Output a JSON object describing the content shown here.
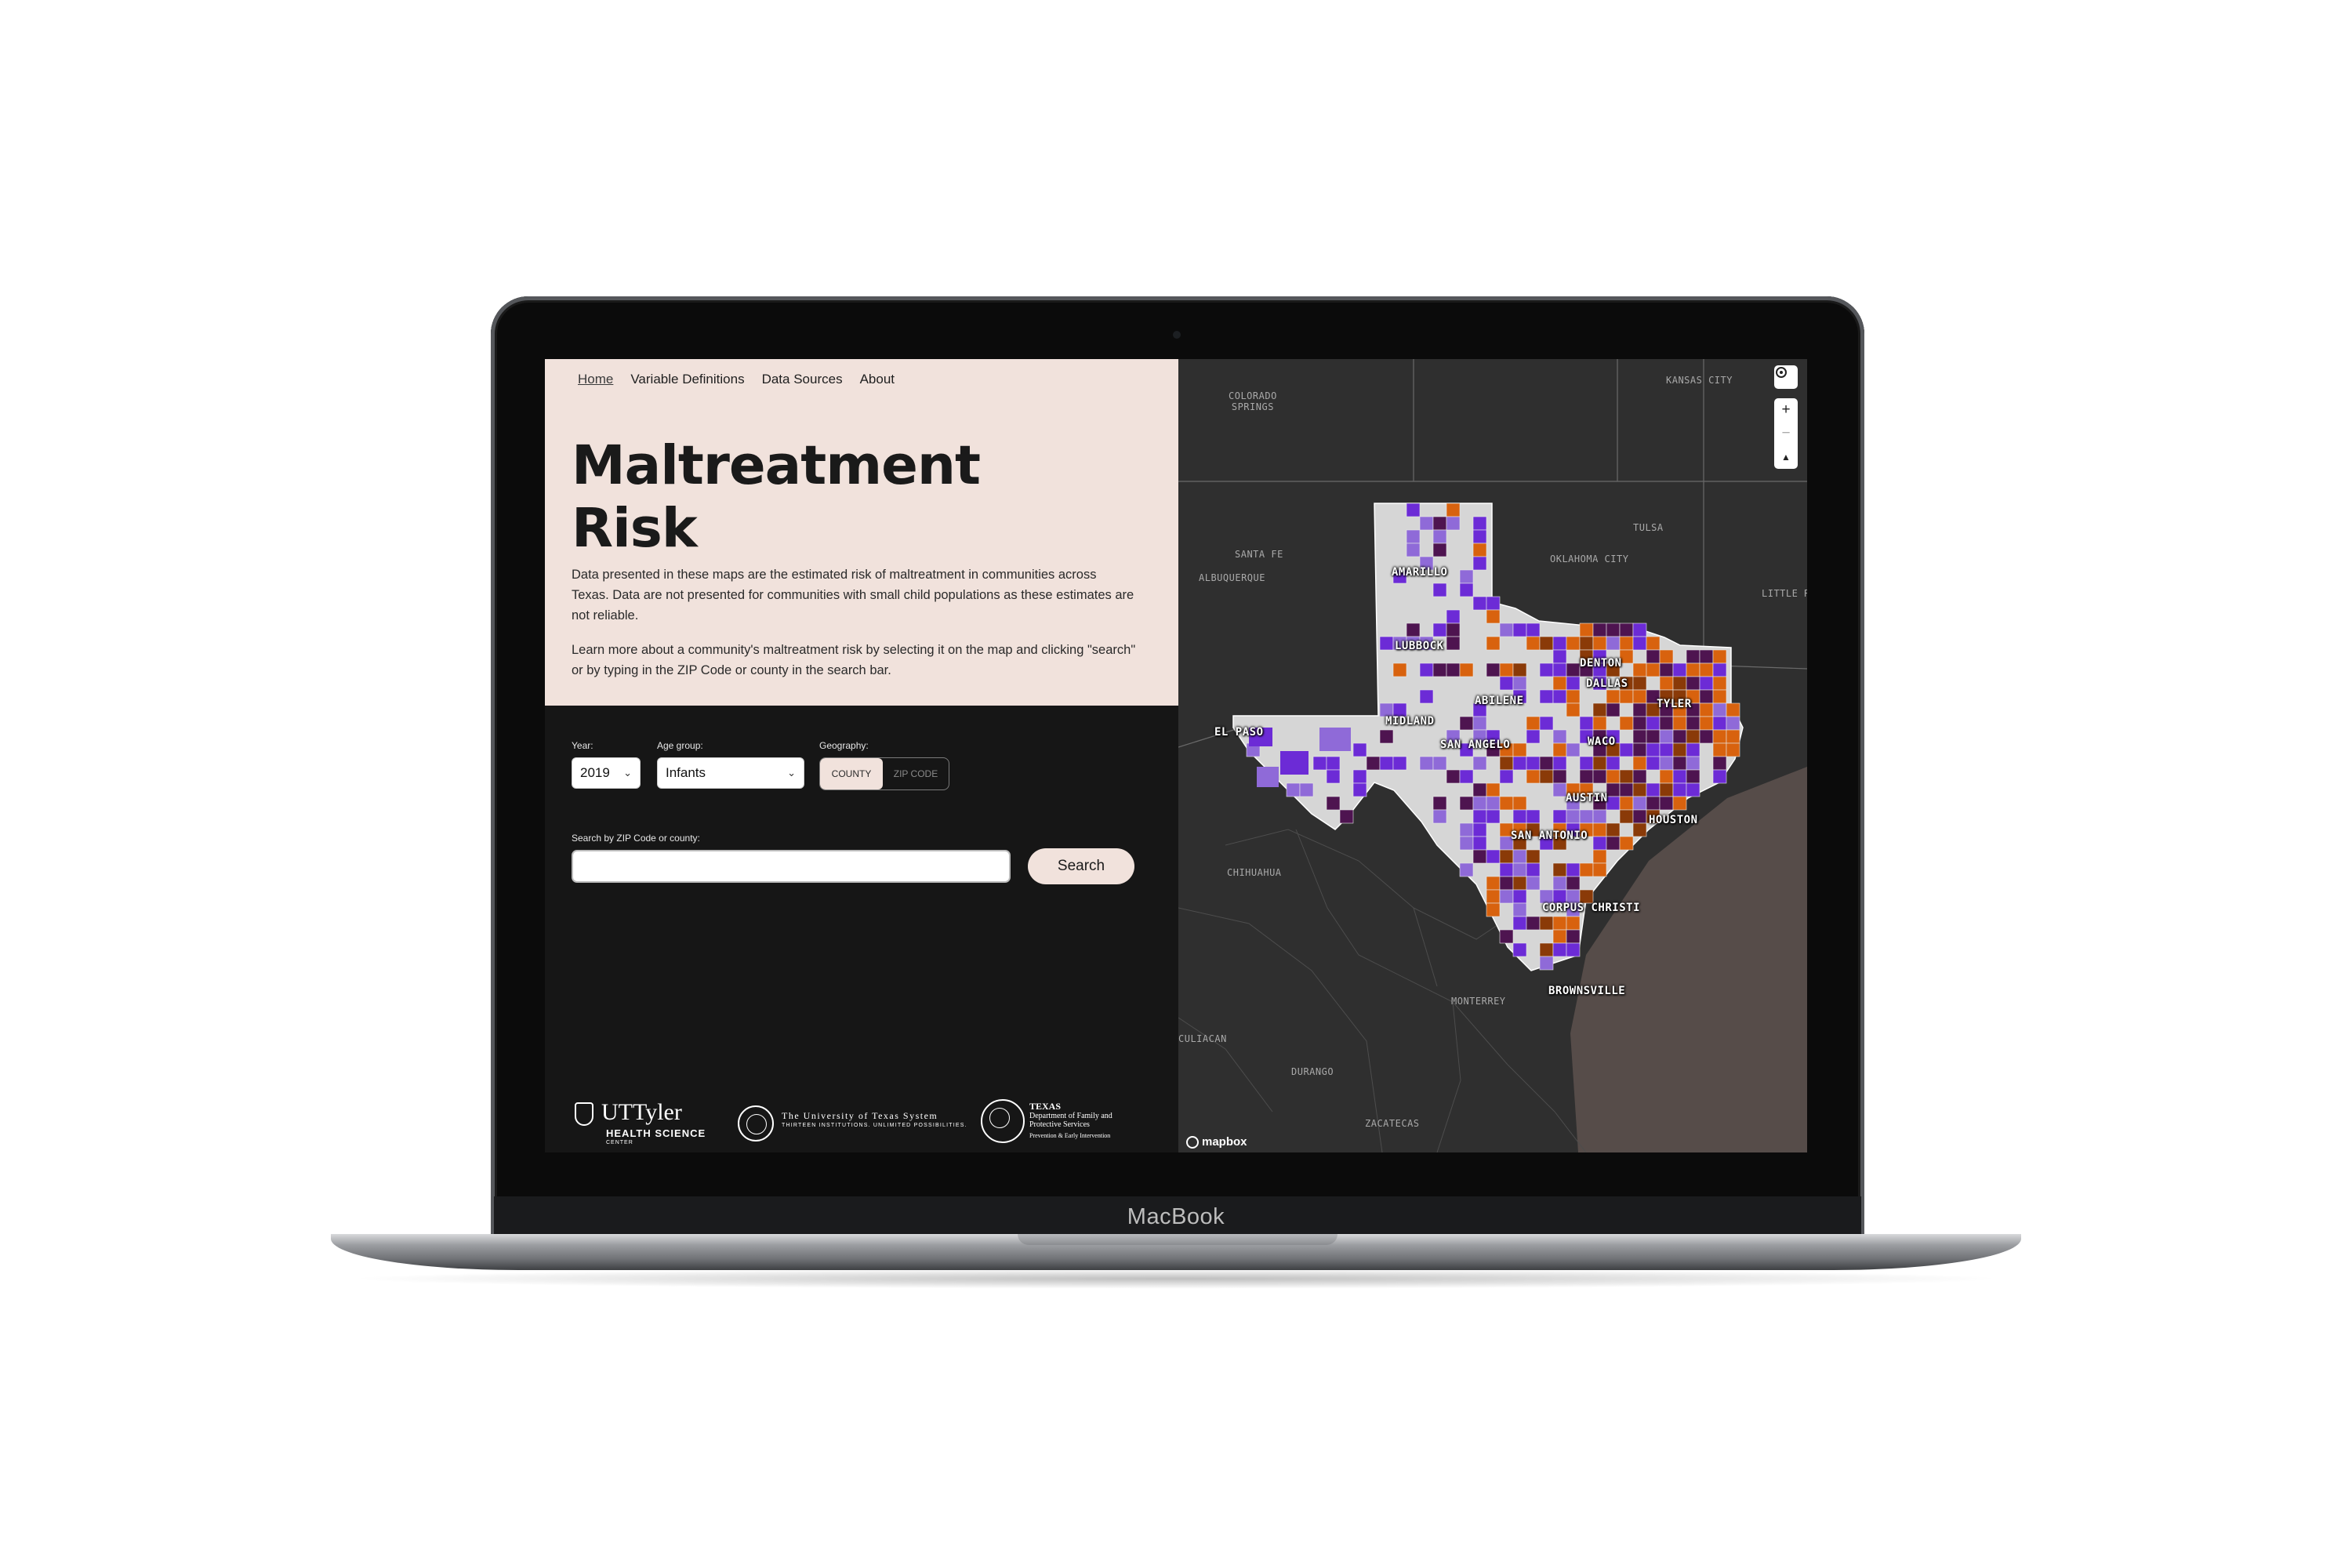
{
  "device": {
    "brand": "MacBook"
  },
  "nav": {
    "home": "Home",
    "variables": "Variable Definitions",
    "sources": "Data Sources",
    "about": "About"
  },
  "hero": {
    "title": "Maltreatment Risk",
    "p1": "Data presented in these maps are the estimated risk of maltreatment in communities across Texas. Data are not presented for communities with small child populations as these estimates are not reliable.",
    "p2": "Learn more about a community's maltreatment risk by selecting it on the map and clicking \"search\" or by typing in the ZIP Code or county in the search bar."
  },
  "controls": {
    "year_label": "Year:",
    "year_value": "2019",
    "age_label": "Age group:",
    "age_value": "Infants",
    "geo_label": "Geography:",
    "geo_county": "COUNTY",
    "geo_zip": "ZIP CODE",
    "search_label": "Search by ZIP Code or county:",
    "search_placeholder": "",
    "search_button": "Search"
  },
  "logos": {
    "ut_name": "UTTyler",
    "ut_sub": "HEALTH SCIENCE",
    "ut_sub2": "CENTER",
    "uts_line1": "The University of Texas System",
    "uts_line2": "THIRTEEN INSTITUTIONS. UNLIMITED POSSIBILITIES.",
    "dfps_line1": "TEXAS",
    "dfps_line2": "Department of Family and Protective Services",
    "dfps_line3": "Prevention & Early Intervention"
  },
  "map": {
    "colors": {
      "background": "#2f2f2f",
      "gulf": "#5a4f4c",
      "texas_gray": "#d6d6d6",
      "lavender": "#8f6ad8",
      "purple": "#6c2bd6",
      "dark_purple": "#4e1450",
      "orange": "#d8620e",
      "brown": "#8a3a08"
    },
    "region_labels": {
      "colorado": "COLORADO\nSPRINGS",
      "kansas": "KANSAS CITY",
      "santafe": "SANTA FE",
      "albuquerque": "ALBUQUERQUE",
      "tulsa": "TULSA",
      "okc": "OKLAHOMA CITY",
      "little": "LITTLE R",
      "chihuahua": "CHIHUAHUA",
      "monterrey": "MONTERREY",
      "culiacan": "CULIACAN",
      "durango": "DURANGO",
      "zacatecas": "ZACATECAS"
    },
    "cities": {
      "amarillo": "AMARILLO",
      "lubbock": "LUBBOCK",
      "denton": "DENTON",
      "dallas": "DALLAS",
      "abilene": "ABILENE",
      "tyler": "TYLER",
      "midland": "MIDLAND",
      "elpaso": "EL PASO",
      "sanangelo": "SAN ANGELO",
      "waco": "WACO",
      "austin": "AUSTIN",
      "houston": "HOUSTON",
      "sanantonio": "SAN ANTONIO",
      "corpus": "CORPUS CHRISTI",
      "brownsville": "BROWNSVILLE"
    },
    "attribution": "mapbox",
    "controls": {
      "locate_icon": "crosshair-icon",
      "zoom_in": "+",
      "zoom_out": "−",
      "compass": "▲"
    }
  }
}
